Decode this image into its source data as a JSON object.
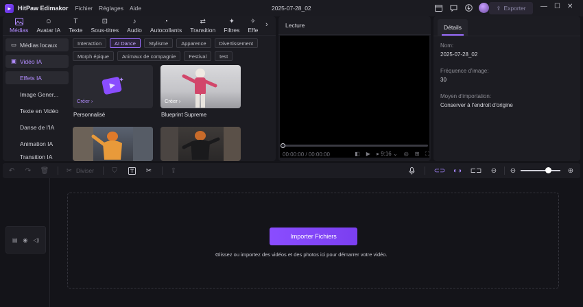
{
  "app": {
    "name": "HitPaw Edimakor",
    "project_title": "2025-07-28_02",
    "menu": [
      "Fichier",
      "Réglages",
      "Aide"
    ],
    "export_label": "Exporter"
  },
  "media_tabs": [
    {
      "label": "Médias",
      "icon": "media-icon"
    },
    {
      "label": "Avatar IA",
      "icon": "avatar-icon"
    },
    {
      "label": "Texte",
      "icon": "text-icon"
    },
    {
      "label": "Sous-titres",
      "icon": "subtitles-icon"
    },
    {
      "label": "Audio",
      "icon": "music-icon"
    },
    {
      "label": "Autocollants",
      "icon": "sticker-icon"
    },
    {
      "label": "Transition",
      "icon": "transition-icon"
    },
    {
      "label": "Filtres",
      "icon": "sparkle-icon"
    },
    {
      "label": "Effe",
      "icon": "effects-icon"
    }
  ],
  "sidebar": {
    "items": [
      {
        "label": "Médias locaux"
      },
      {
        "label": "Vidéo IA"
      },
      {
        "label": "Effets IA"
      },
      {
        "label": "Image Gener..."
      },
      {
        "label": "Texte en Vidéo"
      },
      {
        "label": "Danse de l'IA"
      },
      {
        "label": "Animation IA"
      },
      {
        "label": "Transition IA"
      }
    ]
  },
  "categories": [
    "Interaction",
    "AI Dance",
    "Stylisme",
    "Apparence",
    "Divertissement",
    "Morph épique",
    "Animaux de compagnie",
    "Festival",
    "test"
  ],
  "cards": [
    {
      "title": "Personnalisé",
      "action": "Créer ›"
    },
    {
      "title": "Blueprint Supreme",
      "action": "Créer ›"
    }
  ],
  "preview": {
    "title": "Lecture",
    "time": "00:00:00 / 00:00:00",
    "ratio": "9:16"
  },
  "details": {
    "tab": "Détails",
    "name_label": "Nom:",
    "name_value": "2025-07-28_02",
    "fps_label": "Fréquence d'image:",
    "fps_value": "30",
    "import_label": "Moyen d'importation:",
    "import_value": "Conserver à l'endroit d'origine"
  },
  "timeline": {
    "split_label": "Diviser",
    "import_button": "Importer Fichiers",
    "drop_hint": "Glissez ou importez des vidéos et des photos ici pour démarrer votre vidéo."
  },
  "colors": {
    "accent": "#9b6dff",
    "background": "#141419",
    "panel": "#1c1c22"
  }
}
